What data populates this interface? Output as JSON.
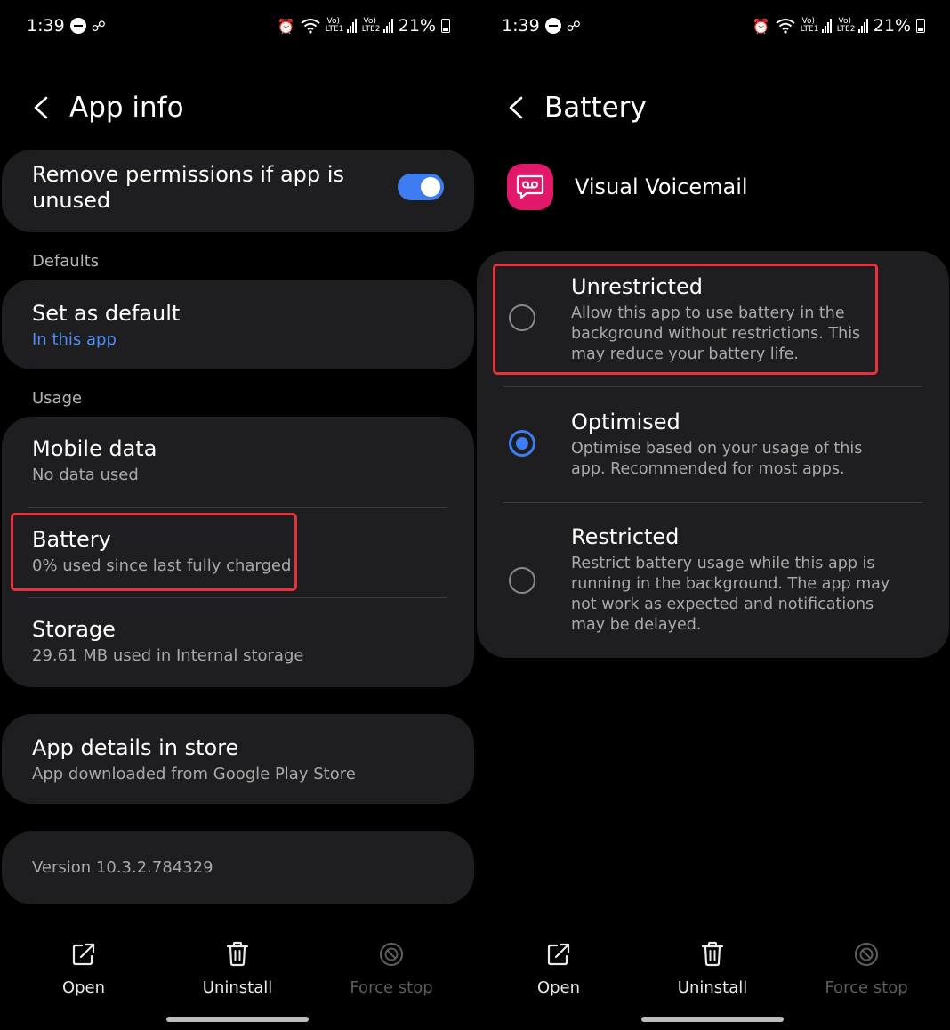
{
  "status_bar": {
    "time": "1:39",
    "battery": "21%",
    "sim1": "Vo) LTE1",
    "sim2": "Vo) LTE2"
  },
  "left_screen": {
    "title": "App info",
    "remove_permissions": {
      "label": "Remove permissions if app is unused",
      "enabled": true
    },
    "defaults_section": "Defaults",
    "set_as_default": {
      "title": "Set as default",
      "subtitle": "In this app"
    },
    "usage_section": "Usage",
    "mobile_data": {
      "title": "Mobile data",
      "subtitle": "No data used"
    },
    "battery": {
      "title": "Battery",
      "subtitle": "0% used since last fully charged"
    },
    "storage": {
      "title": "Storage",
      "subtitle": "29.61 MB used in Internal storage"
    },
    "app_details": {
      "title": "App details in store",
      "subtitle": "App downloaded from Google Play Store"
    },
    "version": "Version 10.3.2.784329"
  },
  "right_screen": {
    "title": "Battery",
    "app_name": "Visual Voicemail",
    "options": [
      {
        "title": "Unrestricted",
        "description": "Allow this app to use battery in the background without restrictions. This may reduce your battery life.",
        "selected": false
      },
      {
        "title": "Optimised",
        "description": "Optimise based on your usage of this app. Recommended for most apps.",
        "selected": true
      },
      {
        "title": "Restricted",
        "description": "Restrict battery usage while this app is running in the background. The app may not work as expected and notifications may be delayed.",
        "selected": false
      }
    ]
  },
  "bottom_bar": {
    "open": "Open",
    "uninstall": "Uninstall",
    "force_stop": "Force stop"
  },
  "colors": {
    "accent": "#3e7cf1",
    "highlight": "#e8323b",
    "app_icon": "#e2186b",
    "link": "#4f8ef7",
    "card": "#1e1e20"
  },
  "icons": [
    "back-chevron-icon",
    "open-external-icon",
    "trash-icon",
    "force-stop-icon",
    "voicemail-icon",
    "alarm-icon",
    "wifi-icon",
    "signal-icon",
    "battery-icon",
    "do-not-disturb-icon"
  ]
}
